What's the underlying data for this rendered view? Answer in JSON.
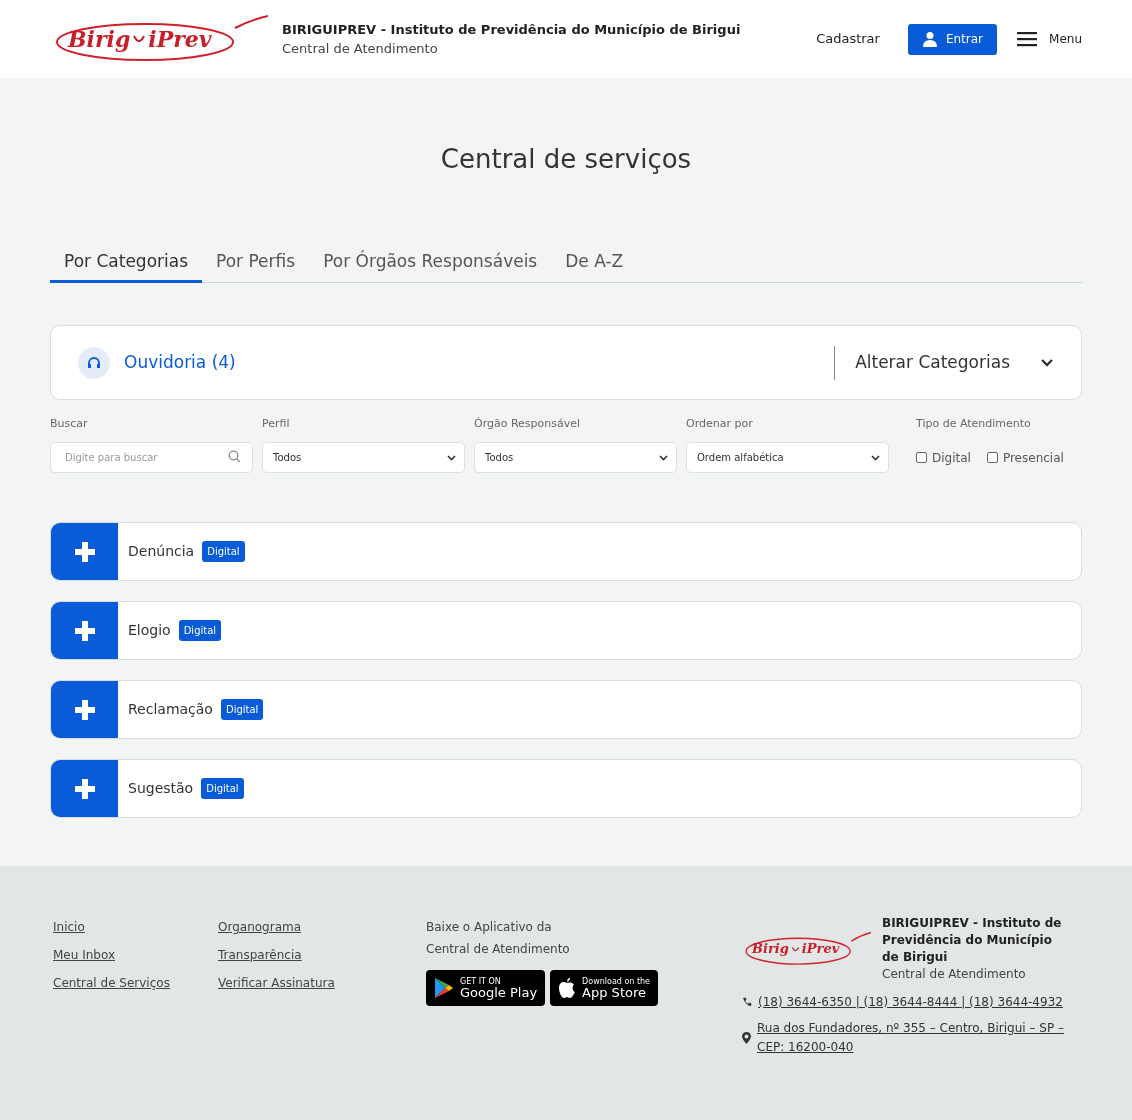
{
  "header": {
    "logo": {
      "left": "Birig",
      "right": "iPrev"
    },
    "title": "BIRIGUIPREV - Instituto de Previdência do Município de Birigui",
    "subtitle": "Central de Atendimento",
    "register": "Cadastrar",
    "login": "Entrar",
    "menu": "Menu"
  },
  "page_title": "Central de serviços",
  "tabs": [
    {
      "label": "Por Categorias",
      "selected": true
    },
    {
      "label": "Por Perfis",
      "selected": false
    },
    {
      "label": "Por Órgãos Responsáveis",
      "selected": false
    },
    {
      "label": "De A-Z",
      "selected": false
    }
  ],
  "category": {
    "name": "Ouvidoria (4)",
    "change": "Alterar Categorias"
  },
  "filters": {
    "search": {
      "label": "Buscar",
      "placeholder": "Digite para buscar"
    },
    "selects": [
      {
        "label": "Perfil",
        "value": "Todos"
      },
      {
        "label": "Órgão Responsável",
        "value": "Todos"
      },
      {
        "label": "Ordenar por",
        "value": "Ordem alfabética"
      }
    ],
    "type": {
      "label": "Tipo de Atendimento",
      "options": [
        {
          "label": "Digital",
          "checked": false
        },
        {
          "label": "Presencial",
          "checked": false
        }
      ]
    }
  },
  "services": [
    {
      "name": "Denúncia",
      "tag": "Digital"
    },
    {
      "name": "Elogio",
      "tag": "Digital"
    },
    {
      "name": "Reclamação",
      "tag": "Digital"
    },
    {
      "name": "Sugestão",
      "tag": "Digital"
    }
  ],
  "footer": {
    "links_1": [
      "Inicio",
      "Meu Inbox",
      "Central de Serviços"
    ],
    "links_2": [
      "Organograma",
      "Transparência",
      "Verificar Assinatura"
    ],
    "app_text": "Baixe o Aplicativo da Central de Atendimento",
    "google": {
      "small": "GET IT ON",
      "big": "Google Play"
    },
    "apple": {
      "small": "Download on the",
      "big": "App Store"
    },
    "logo": {
      "left": "Birig",
      "right": "iPrev"
    },
    "org_name": "BIRIGUIPREV - Instituto de Previdência do Município de Birigui",
    "org_sub": "Central de Atendimento",
    "phones": "(18) 3644-6350 | (18) 3644-8444 | (18) 3644-4932",
    "address": "Rua dos Fundadores, nº 355 – Centro, Birigui – SP – CEP: 16200-040"
  }
}
